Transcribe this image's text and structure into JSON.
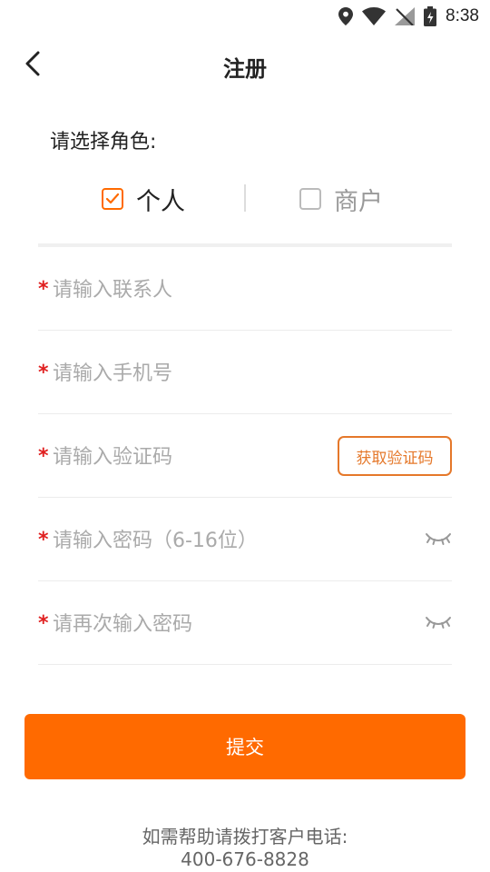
{
  "status_bar": {
    "time": "8:38",
    "icons": [
      "location-icon",
      "wifi-icon",
      "no-signal-icon",
      "battery-charging-icon"
    ]
  },
  "header": {
    "title": "注册",
    "back_icon": "chevron-left-icon"
  },
  "role": {
    "label": "请选择角色:",
    "options": [
      {
        "label": "个人",
        "checked": true
      },
      {
        "label": "商户",
        "checked": false
      }
    ]
  },
  "form": {
    "required_mark": "*",
    "contact_placeholder": "请输入联系人",
    "phone_placeholder": "请输入手机号",
    "code_placeholder": "请输入验证码",
    "get_code_label": "获取验证码",
    "password_placeholder": "请输入密码（6-16位）",
    "confirm_placeholder": "请再次输入密码"
  },
  "submit_label": "提交",
  "help": {
    "text": "如需帮助请拨打客户电话:",
    "phone": "400-676-8828"
  },
  "colors": {
    "accent": "#ff6a00",
    "required": "#e02020",
    "placeholder": "#aaaaaa"
  }
}
